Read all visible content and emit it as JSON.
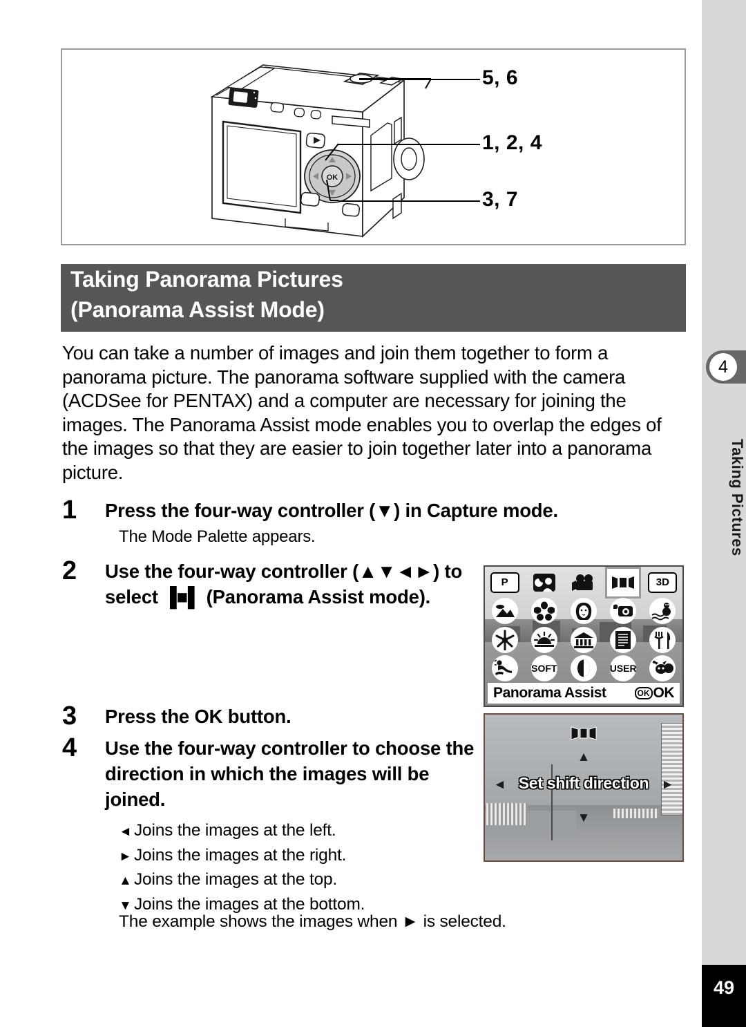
{
  "page": {
    "number": "49",
    "chapter_number": "4",
    "chapter_title": "Taking Pictures"
  },
  "illustration": {
    "caption_alt": "camera-rear-view",
    "callouts": [
      {
        "label": "5, 6"
      },
      {
        "label": "1, 2, 4"
      },
      {
        "label": "3, 7"
      }
    ]
  },
  "title": {
    "line1": "Taking Panorama Pictures",
    "line2": "(Panorama Assist Mode)"
  },
  "intro": {
    "paragraph": "You can take a number of images and join them together to form a panorama picture. The panorama software supplied with the camera (ACDSee for PENTAX) and a computer are necessary for joining the images. The Panorama Assist mode enables you to overlap the edges of the images so that they are easier to join together later into a panorama picture."
  },
  "steps": [
    {
      "number": "1",
      "text": "Press the four-way controller (▼) in Capture mode.",
      "sub": "The Mode Palette appears."
    },
    {
      "number": "2",
      "text": "Use the four-way controller (▲▼◄►) to select ▐■▌ (Panorama Assist mode)."
    },
    {
      "number": "3",
      "text": "Press the OK button."
    },
    {
      "number": "4",
      "text": "Use the four-way controller to choose the direction in which the images will be joined."
    }
  ],
  "directions": [
    {
      "arrow": "◄",
      "text": "Joins the images at the left."
    },
    {
      "arrow": "►",
      "text": "Joins the images at the right."
    },
    {
      "arrow": "▲",
      "text": "Joins the images at the top."
    },
    {
      "arrow": "▼",
      "text": "Joins the images at the bottom."
    }
  ],
  "example_note": "The example shows the images when ► is selected.",
  "mode_palette": {
    "selected_label": "Panorama Assist",
    "ok_badge": "OK",
    "ok_label": "OK",
    "icons": [
      {
        "name": "program-mode-icon",
        "glyph": "P",
        "style": "square"
      },
      {
        "name": "night-scene-icon",
        "glyph": "",
        "style": "night"
      },
      {
        "name": "movie-mode-icon",
        "glyph": "",
        "style": "movie"
      },
      {
        "name": "panorama-assist-icon",
        "glyph": "",
        "style": "panorama",
        "selected": true
      },
      {
        "name": "three-d-mode-icon",
        "glyph": "3D",
        "style": "square"
      },
      {
        "name": "landscape-mode-icon",
        "glyph": "",
        "style": "landscape"
      },
      {
        "name": "flower-mode-icon",
        "glyph": "",
        "style": "flower"
      },
      {
        "name": "portrait-mode-icon",
        "glyph": "",
        "style": "portrait"
      },
      {
        "name": "self-portrait-icon",
        "glyph": "",
        "style": "selfportrait"
      },
      {
        "name": "surf-snow-icon",
        "glyph": "",
        "style": "surfsnow"
      },
      {
        "name": "autumn-mode-icon",
        "glyph": "",
        "style": "autumn"
      },
      {
        "name": "sunset-mode-icon",
        "glyph": "",
        "style": "sunset"
      },
      {
        "name": "museum-mode-icon",
        "glyph": "",
        "style": "museum"
      },
      {
        "name": "text-mode-icon",
        "glyph": "",
        "style": "text"
      },
      {
        "name": "food-mode-icon",
        "glyph": "",
        "style": "food"
      },
      {
        "name": "sport-mode-icon",
        "glyph": "",
        "style": "sport"
      },
      {
        "name": "soft-mode-icon",
        "glyph": "SOFT",
        "style": "word"
      },
      {
        "name": "half-length-icon",
        "glyph": "",
        "style": "halflength"
      },
      {
        "name": "user-mode-icon",
        "glyph": "USER",
        "style": "word"
      },
      {
        "name": "pet-mode-icon",
        "glyph": "",
        "style": "pet"
      }
    ]
  },
  "shift_screen": {
    "caption": "Set shift direction",
    "up_arrow": "▲",
    "down_arrow": "▼",
    "left_arrow": "◄",
    "right_arrow": "►"
  }
}
